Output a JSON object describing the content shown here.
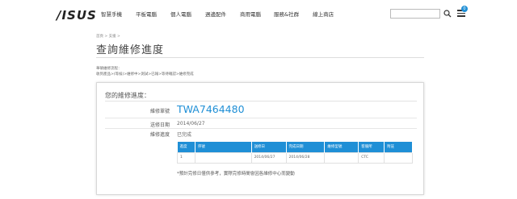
{
  "header": {
    "logo": "/ISUS",
    "nav": [
      "智慧手機",
      "平板電腦",
      "個人電腦",
      "週邊配件",
      "商用電腦",
      "服務&社群",
      "線上商店"
    ],
    "search_placeholder": "",
    "cart_count": "0"
  },
  "breadcrumb": "首頁 > 支援 >",
  "page_title": "查詢維修進度",
  "process": {
    "label": "華碩維修流程：",
    "steps": "收到產品>(等候)>維修中>測試>已報>等待確認>維修完成"
  },
  "panel": {
    "title": "您的維修進度：",
    "ticket_label": "維修單號",
    "ticket_no": "TWA7464480",
    "date_label": "送修日期",
    "date_value": "2014/06/27",
    "status_label": "維修進度",
    "status_value": "已完成",
    "table": {
      "headers": [
        "進度",
        "序號",
        "送修日",
        "完成日期",
        "維修型號",
        "客服所",
        "附註"
      ],
      "rows": [
        [
          "1",
          "",
          "2014/06/27",
          "2014/06/28",
          "",
          "CTC",
          ""
        ]
      ]
    },
    "note": "*預計完修日僅供參考，實際完修時間會因各維修中心而變動"
  },
  "colors": {
    "accent": "#1f8fd6"
  }
}
